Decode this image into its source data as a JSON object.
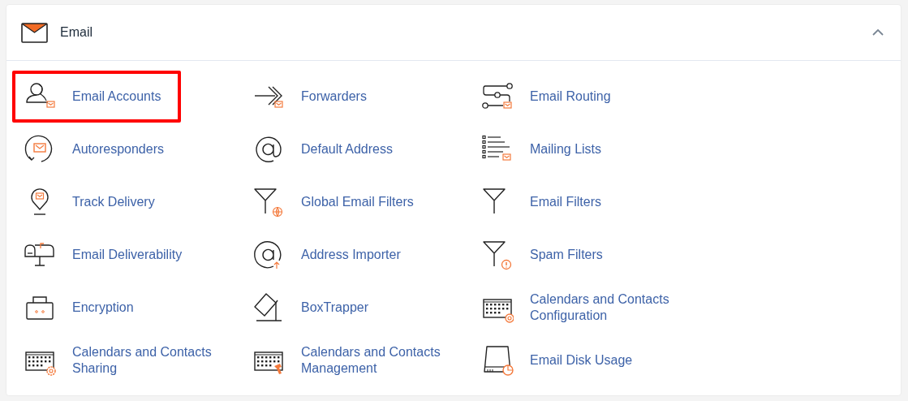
{
  "panel": {
    "title": "Email",
    "expanded": true
  },
  "rows": [
    {
      "items": [
        {
          "label": "Email Accounts",
          "highlighted": true
        },
        {
          "label": "Forwarders",
          "highlighted": false
        },
        {
          "label": "Email Routing",
          "highlighted": false
        }
      ]
    },
    {
      "items": [
        {
          "label": "Autoresponders",
          "highlighted": false
        },
        {
          "label": "Default Address",
          "highlighted": false
        },
        {
          "label": "Mailing Lists",
          "highlighted": false
        }
      ]
    },
    {
      "items": [
        {
          "label": "Track Delivery",
          "highlighted": false
        },
        {
          "label": "Global Email Filters",
          "highlighted": false
        },
        {
          "label": "Email Filters",
          "highlighted": false
        }
      ]
    },
    {
      "items": [
        {
          "label": "Email Deliverability",
          "highlighted": false
        },
        {
          "label": "Address Importer",
          "highlighted": false
        },
        {
          "label": "Spam Filters",
          "highlighted": false
        }
      ]
    },
    {
      "items": [
        {
          "label": "Encryption",
          "highlighted": false
        },
        {
          "label": "BoxTrapper",
          "highlighted": false
        },
        {
          "label": "Calendars and Contacts Configuration",
          "highlighted": false
        }
      ]
    },
    {
      "items": [
        {
          "label": "Calendars and Contacts Sharing",
          "highlighted": false
        },
        {
          "label": "Calendars and Contacts Management",
          "highlighted": false
        },
        {
          "label": "Email Disk Usage",
          "highlighted": false
        }
      ]
    }
  ]
}
